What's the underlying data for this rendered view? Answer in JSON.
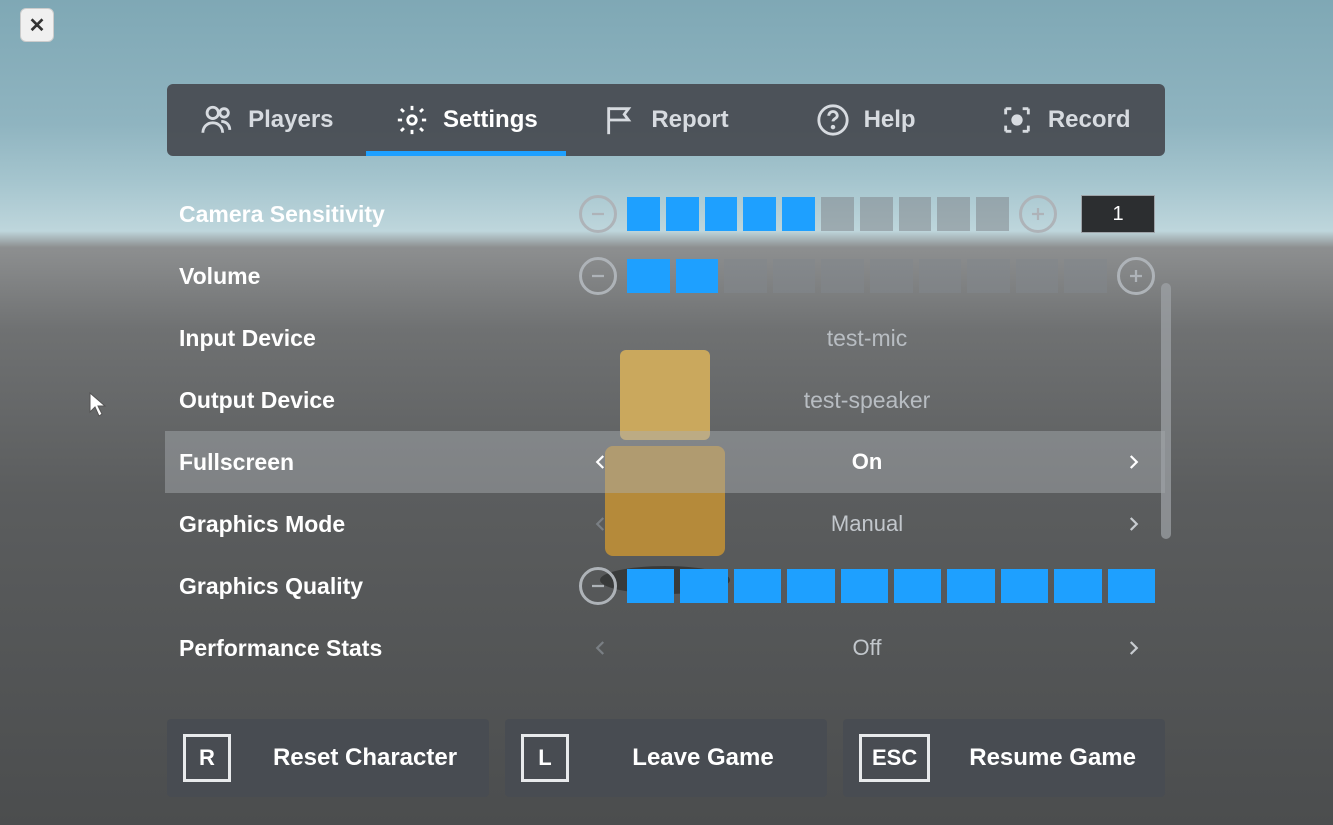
{
  "close_label": "✕",
  "tabs": {
    "players": "Players",
    "settings": "Settings",
    "report": "Report",
    "help": "Help",
    "record": "Record"
  },
  "rows": {
    "camera": {
      "label": "Camera Sensitivity",
      "filled": 5,
      "total": 10,
      "value": "1"
    },
    "volume": {
      "label": "Volume",
      "filled": 2,
      "total": 10
    },
    "input": {
      "label": "Input Device",
      "value": "test-mic"
    },
    "output": {
      "label": "Output Device",
      "value": "test-speaker"
    },
    "fullscreen": {
      "label": "Fullscreen",
      "value": "On"
    },
    "gmode": {
      "label": "Graphics Mode",
      "value": "Manual"
    },
    "gquality": {
      "label": "Graphics Quality",
      "filled": 10,
      "total": 10
    },
    "perf": {
      "label": "Performance Stats",
      "value": "Off"
    }
  },
  "buttons": {
    "reset": {
      "key": "R",
      "label": "Reset Character"
    },
    "leave": {
      "key": "L",
      "label": "Leave Game"
    },
    "resume": {
      "key": "ESC",
      "label": "Resume Game"
    }
  }
}
